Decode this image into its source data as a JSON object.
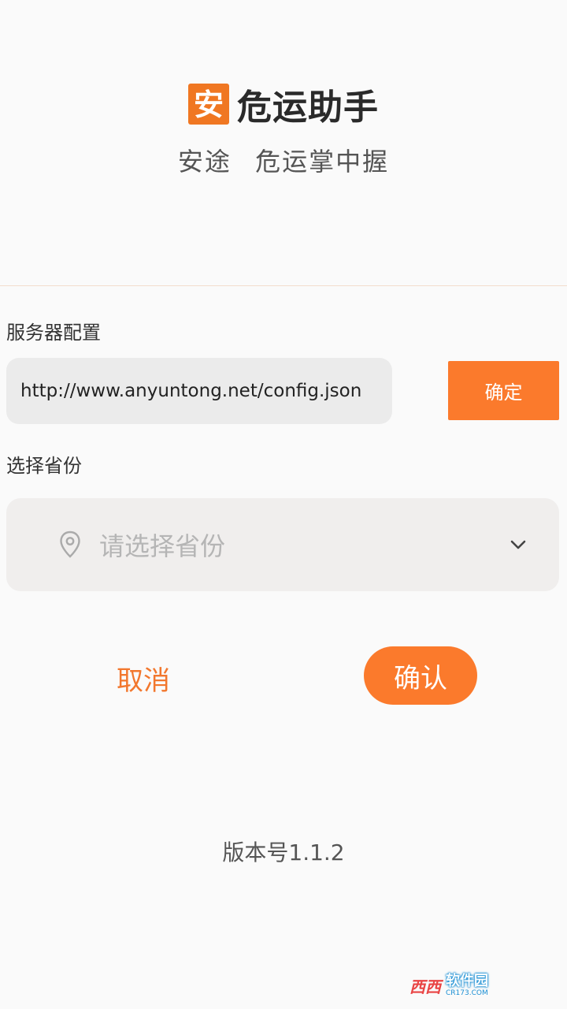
{
  "app": {
    "title": "危运助手",
    "logo_char": "安",
    "slogan": "安途  危运掌中握"
  },
  "server_config": {
    "label": "服务器配置",
    "url_value": "http://www.anyuntong.net/config.json",
    "confirm_label": "确定"
  },
  "province": {
    "label": "选择省份",
    "placeholder": "请选择省份",
    "icon": "location-pin-icon",
    "dropdown_icon": "chevron-down-icon"
  },
  "actions": {
    "cancel_label": "取消",
    "ok_label": "确认"
  },
  "footer": {
    "version": "版本号1.1.2"
  },
  "watermark": {
    "logo": "西西",
    "name": "软件园",
    "site": "CR173.COM"
  },
  "colors": {
    "accent": "#fb7a2c",
    "input_bg": "#ebebeb",
    "select_bg": "#f0eeed",
    "page_bg": "#fafafa"
  }
}
